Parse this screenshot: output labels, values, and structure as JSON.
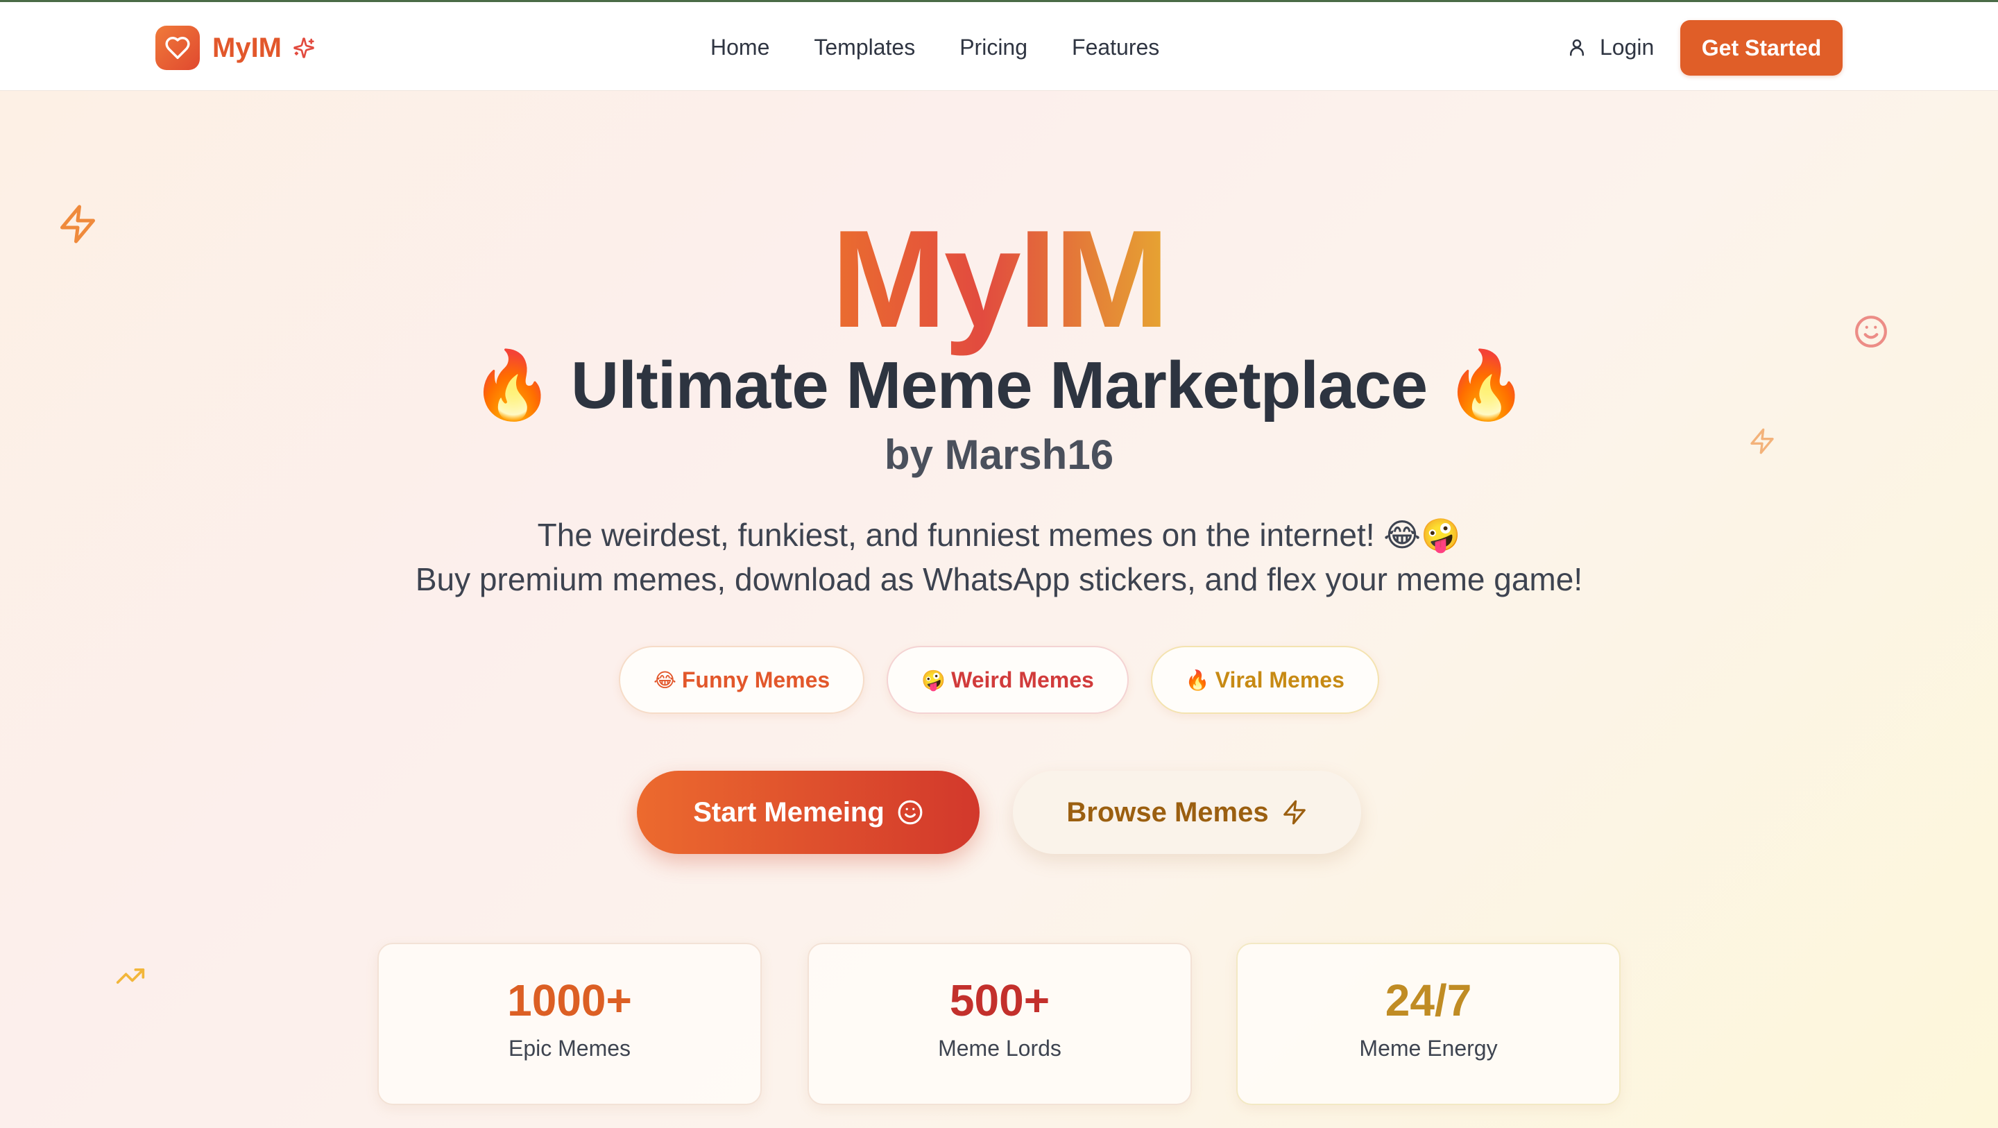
{
  "navbar": {
    "brand": "MyIM",
    "links": [
      "Home",
      "Templates",
      "Pricing",
      "Features"
    ],
    "login": "Login",
    "cta": "Get Started"
  },
  "hero": {
    "title": "MyIM",
    "subtitle": "🔥 Ultimate Meme Marketplace 🔥",
    "byline": "by Marsh16",
    "description_line1": "The weirdest, funkiest, and funniest memes on the internet! 😂🤪",
    "description_line2": "Buy premium memes, download as WhatsApp stickers, and flex your meme game!"
  },
  "pills": [
    {
      "emoji": "😂",
      "label": "Funny Memes"
    },
    {
      "emoji": "🤪",
      "label": "Weird Memes"
    },
    {
      "emoji": "🔥",
      "label": "Viral Memes"
    }
  ],
  "ctas": {
    "primary": "Start Memeing",
    "secondary": "Browse Memes"
  },
  "stats": [
    {
      "value": "1000+",
      "label": "Epic Memes"
    },
    {
      "value": "500+",
      "label": "Meme Lords"
    },
    {
      "value": "24/7",
      "label": "Meme Energy"
    }
  ],
  "icons": {
    "brand_logo": "heart-icon",
    "brand_spark": "sparkles-icon",
    "login": "user-icon",
    "start": "smile-icon",
    "browse": "zap-icon"
  },
  "colors": {
    "accent": "#e05e28",
    "title_gradient": [
      "#ea6d2f",
      "#e24b3f",
      "#e6a532"
    ]
  }
}
